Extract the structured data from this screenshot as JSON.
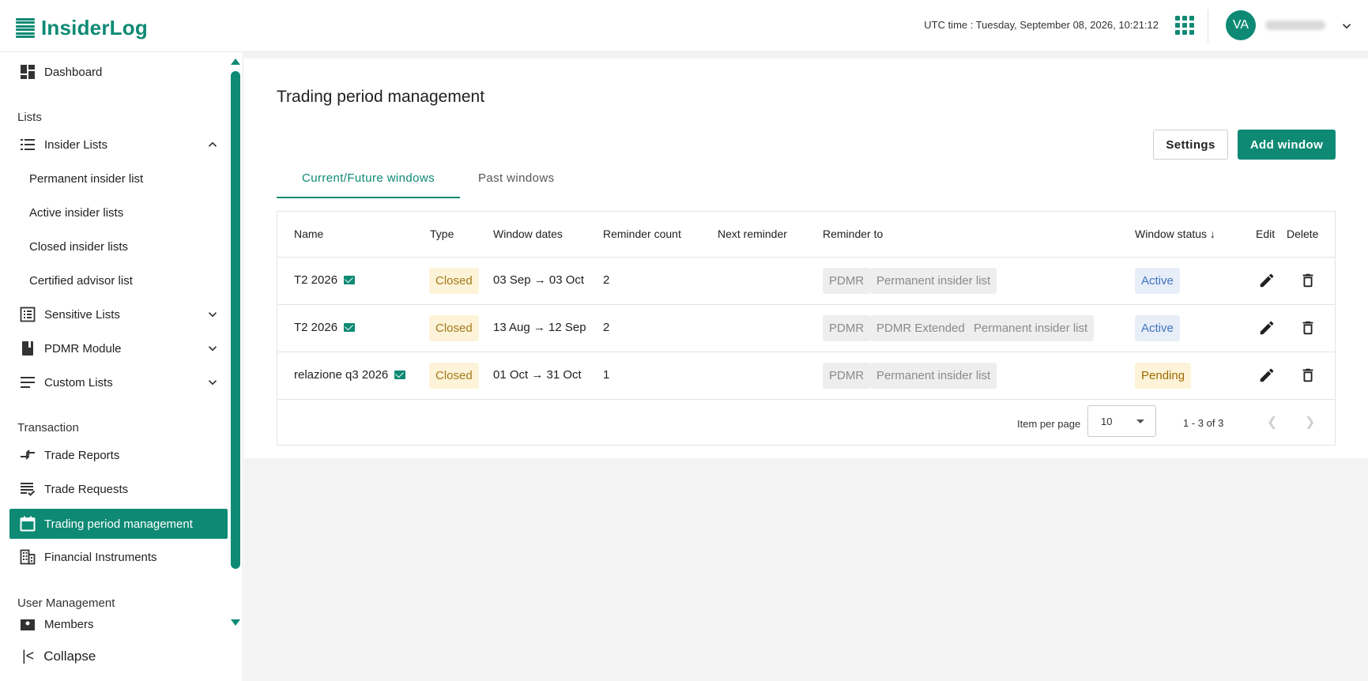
{
  "header": {
    "logo_text": "InsiderLog",
    "utc_time": "UTC time : Tuesday, September 08, 2026, 10:21:12",
    "avatar_initials": "VA"
  },
  "sidebar": {
    "dashboard": "Dashboard",
    "section_lists": "Lists",
    "insider_lists": "Insider Lists",
    "sub_items": [
      "Permanent insider list",
      "Active insider lists",
      "Closed insider lists",
      "Certified advisor list"
    ],
    "sensitive_lists": "Sensitive Lists",
    "pdmr_module": "PDMR Module",
    "custom_lists": "Custom Lists",
    "section_transaction": "Transaction",
    "trade_reports": "Trade Reports",
    "trade_requests": "Trade Requests",
    "trading_period_management": "Trading period management",
    "financial_instruments": "Financial Instruments",
    "section_user_management": "User Management",
    "members": "Members",
    "collapse": "Collapse"
  },
  "main": {
    "title": "Trading period management",
    "settings_button": "Settings",
    "add_window_button": "Add window",
    "tabs": [
      {
        "label": "Current/Future windows",
        "active": true
      },
      {
        "label": "Past windows",
        "active": false
      }
    ],
    "table": {
      "headers": {
        "name": "Name",
        "type": "Type",
        "window_dates": "Window dates",
        "reminder_count": "Reminder count",
        "next_reminder": "Next reminder",
        "reminder_to": "Reminder to",
        "window_status": "Window status ↓",
        "edit": "Edit",
        "delete": "Delete"
      },
      "rows": [
        {
          "name": "T2 2026",
          "type": "Closed",
          "dates": "03 Sep → 03 Oct",
          "count": "2",
          "next": "",
          "reminder_to": [
            "PDMR",
            "Permanent insider list"
          ],
          "status": "Active"
        },
        {
          "name": "T2 2026",
          "type": "Closed",
          "dates": "13 Aug → 12 Sep",
          "count": "2",
          "next": "",
          "reminder_to": [
            "PDMR",
            "PDMR Extended",
            "Permanent insider list"
          ],
          "status": "Active"
        },
        {
          "name": "relazione q3 2026",
          "type": "Closed",
          "dates": "01 Oct → 31 Oct",
          "count": "1",
          "next": "",
          "reminder_to": [
            "PDMR",
            "Permanent insider list"
          ],
          "status": "Pending"
        }
      ]
    },
    "pager": {
      "label": "Item per page",
      "per_page": "10",
      "range": "1 - 3 of 3"
    }
  },
  "colors": {
    "brand": "#0e8a74",
    "closed_bg": "#fdf3d8",
    "active_bg": "#e8eef7"
  }
}
